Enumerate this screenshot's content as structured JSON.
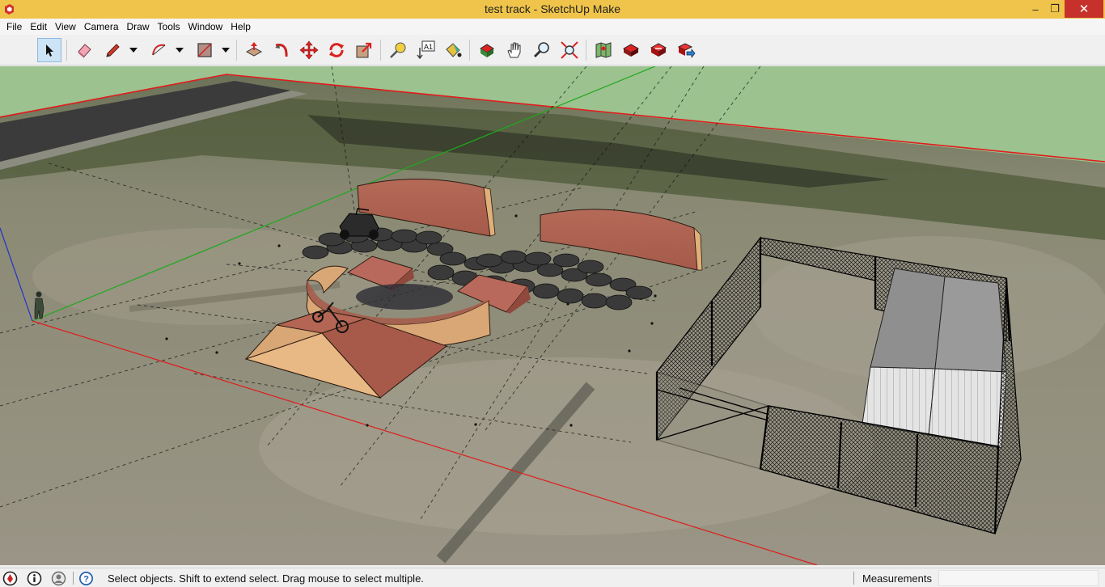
{
  "window": {
    "title": "test track - SketchUp Make",
    "minimize": "–",
    "maximize": "❐",
    "close": "✕"
  },
  "menu": {
    "items": [
      "File",
      "Edit",
      "View",
      "Camera",
      "Draw",
      "Tools",
      "Window",
      "Help"
    ]
  },
  "toolbar": {
    "tools": [
      {
        "name": "select-tool",
        "icon": "arrow-cursor-icon",
        "active": true
      },
      {
        "name": "eraser-tool",
        "icon": "eraser-icon"
      },
      {
        "name": "line-tool",
        "icon": "pencil-icon"
      },
      {
        "name": "arc-tool",
        "icon": "arc-icon"
      },
      {
        "name": "rectangle-tool",
        "icon": "rectangle-icon"
      },
      {
        "name": "push-pull-tool",
        "icon": "push-pull-icon"
      },
      {
        "name": "follow-me-tool",
        "icon": "follow-me-icon"
      },
      {
        "name": "move-tool",
        "icon": "move-icon"
      },
      {
        "name": "rotate-tool",
        "icon": "rotate-icon"
      },
      {
        "name": "scale-tool",
        "icon": "scale-icon"
      },
      {
        "name": "tape-measure-tool",
        "icon": "tape-measure-icon"
      },
      {
        "name": "text-tool",
        "icon": "text-icon"
      },
      {
        "name": "paint-bucket-tool",
        "icon": "paint-bucket-icon"
      },
      {
        "name": "orbit-tool",
        "icon": "orbit-icon"
      },
      {
        "name": "pan-tool",
        "icon": "hand-icon"
      },
      {
        "name": "zoom-tool",
        "icon": "magnifier-icon"
      },
      {
        "name": "zoom-extents-tool",
        "icon": "zoom-extents-icon"
      },
      {
        "name": "get-models-button",
        "icon": "map-location-icon"
      },
      {
        "name": "share-model-button",
        "icon": "share-model-icon"
      },
      {
        "name": "warehouse-button",
        "icon": "3d-warehouse-icon"
      },
      {
        "name": "extension-warehouse-button",
        "icon": "extension-warehouse-icon"
      }
    ],
    "text_tool_label": "A1"
  },
  "colors": {
    "titlebar": "#f0c44a",
    "close": "#c7312b",
    "sky": "#9cc28f",
    "axis_red": "#e01c1c",
    "axis_green": "#1ea81e",
    "axis_blue": "#2233cc",
    "ramp_tan": "#d9a775",
    "ramp_brown": "#a85a4a"
  },
  "statusbar": {
    "message": "Select objects. Shift to extend select. Drag mouse to select multiple.",
    "measurements_label": "Measurements",
    "measurements_value": "",
    "icons": [
      "geo-location-icon",
      "credits-icon",
      "user-icon",
      "help-icon"
    ]
  }
}
